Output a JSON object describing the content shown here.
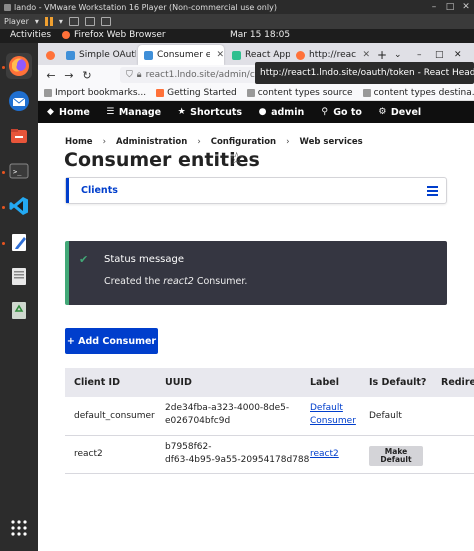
{
  "vm": {
    "title": "lando - VMware Workstation 16 Player (Non-commercial use only)",
    "player_label": "Player"
  },
  "gnome": {
    "activities": "Activities",
    "app_name": "Firefox Web Browser",
    "clock": "Mar 15  18:05"
  },
  "browser": {
    "tabs": [
      {
        "label": "Simple OAuth"
      },
      {
        "label": "Consumer en"
      },
      {
        "label": "React App"
      },
      {
        "label": "http://react1"
      }
    ],
    "url": "react1.lndo.site/admin/co",
    "tooltip": "http://react1.lndo.site/oauth/token - React Headless Drupal",
    "bookmarks": [
      {
        "label": "Import bookmarks..."
      },
      {
        "label": "Getting Started"
      },
      {
        "label": "content types source"
      },
      {
        "label": "content types destina..."
      }
    ]
  },
  "toolbar": {
    "home": "Home",
    "manage": "Manage",
    "shortcuts": "Shortcuts",
    "admin": "admin",
    "goto": "Go to",
    "devel": "Devel"
  },
  "breadcrumb": [
    "Home",
    "Administration",
    "Configuration",
    "Web services"
  ],
  "page": {
    "title": "Consumer entities",
    "tab_clients": "Clients"
  },
  "status": {
    "header": "Status message",
    "msg_prefix": "Created the ",
    "msg_name": "react2",
    "msg_suffix": " Consumer."
  },
  "add_button": "+ Add Consumer",
  "table": {
    "headers": [
      "Client ID",
      "UUID",
      "Label",
      "Is Default?",
      "Redirect"
    ],
    "rows": [
      {
        "client_id": "default_consumer",
        "uuid_1": "2de34fba-a323-4000-8de5-",
        "uuid_2": "e026704bfc9d",
        "label_1": "Default",
        "label_2": "Consumer",
        "is_default": "Default"
      },
      {
        "client_id": "react2",
        "uuid_1": "b7958f62-",
        "uuid_2": "df63-4b95-9a55-20954178d788",
        "label_1": "react2",
        "make_default_1": "Make",
        "make_default_2": "Default"
      }
    ]
  },
  "colors": {
    "drupal_blue": "#003ecc",
    "status_green": "#42a877",
    "toolbar_bg": "#0f0f0f"
  }
}
